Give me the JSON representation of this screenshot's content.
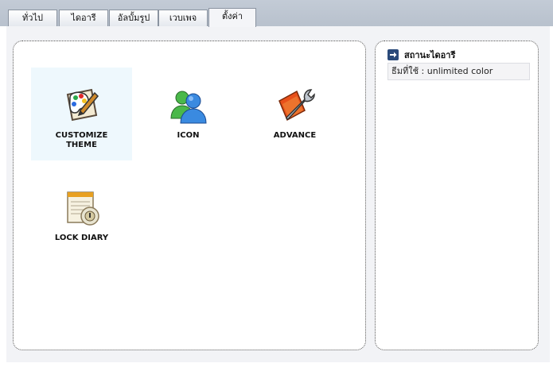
{
  "tabs": [
    {
      "label": "ทั่วไป"
    },
    {
      "label": "ไดอารี"
    },
    {
      "label": "อัลบั้มรูป"
    },
    {
      "label": "เวบเพจ"
    },
    {
      "label": "ตั้งค่า",
      "active": true
    }
  ],
  "tiles": [
    {
      "label": "CUSTOMIZE\nTHEME",
      "icon": "palette-icon",
      "selected": true
    },
    {
      "label": "ICON",
      "icon": "users-icon"
    },
    {
      "label": "ADVANCE",
      "icon": "wrench-icon"
    },
    {
      "label": "LOCK DIARY",
      "icon": "lock-diary-icon"
    }
  ],
  "sidebar": {
    "title": "สถานะไดอารี",
    "title_icon": "arrow-right-icon",
    "theme_status": "ธีมที่ใช้ : unlimited color"
  },
  "colors": {
    "tabbar": "#c3cbd6",
    "workspace": "#f2f3f6",
    "selected_tile": "#eef8fd",
    "arrow_box": "#2b4a7a"
  }
}
